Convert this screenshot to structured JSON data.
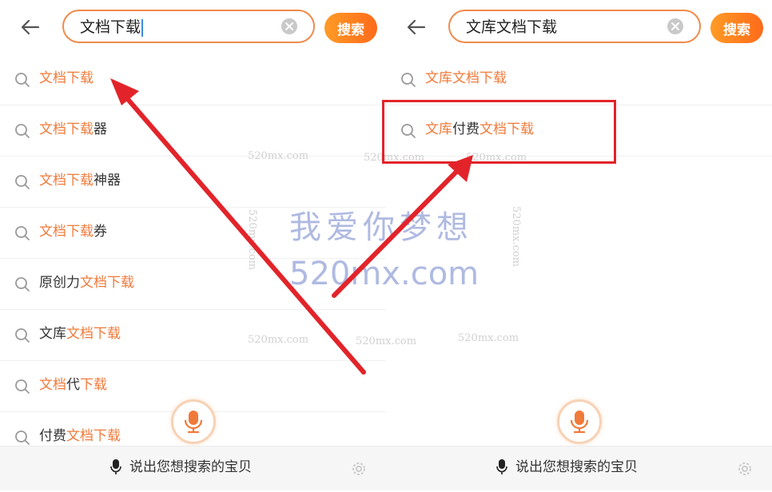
{
  "left_panel": {
    "query": "文档下载",
    "search_button": "搜索",
    "suggestions": [
      {
        "parts": [
          {
            "t": "文档下载",
            "h": true
          }
        ]
      },
      {
        "parts": [
          {
            "t": "文档下载",
            "h": true
          },
          {
            "t": "器",
            "h": false
          }
        ]
      },
      {
        "parts": [
          {
            "t": "文档下载",
            "h": true
          },
          {
            "t": "神器",
            "h": false
          }
        ]
      },
      {
        "parts": [
          {
            "t": "文档下载",
            "h": true
          },
          {
            "t": "券",
            "h": false
          }
        ]
      },
      {
        "parts": [
          {
            "t": "原创力",
            "h": false
          },
          {
            "t": "文档下载",
            "h": true
          }
        ]
      },
      {
        "parts": [
          {
            "t": "文库",
            "h": false
          },
          {
            "t": "文档下载",
            "h": true
          }
        ]
      },
      {
        "parts": [
          {
            "t": "文档",
            "h": true
          },
          {
            "t": "代",
            "h": false
          },
          {
            "t": "下载",
            "h": true
          }
        ]
      },
      {
        "parts": [
          {
            "t": "付费",
            "h": false
          },
          {
            "t": "文档下载",
            "h": true
          }
        ]
      }
    ],
    "voice_label": "说出您想搜索的宝贝"
  },
  "right_panel": {
    "query": "文库文档下载",
    "search_button": "搜索",
    "suggestions": [
      {
        "parts": [
          {
            "t": "文库文档下载",
            "h": true
          }
        ]
      },
      {
        "parts": [
          {
            "t": "文库",
            "h": true
          },
          {
            "t": "付费",
            "h": false
          },
          {
            "t": "文档下载",
            "h": true
          }
        ]
      }
    ],
    "voice_label": "说出您想搜索的宝贝"
  },
  "watermark": {
    "title": "我爱你梦想",
    "site": "520mx.com",
    "small": "520mx.com"
  },
  "colors": {
    "accent": "#f07a3a",
    "search_border": "#f08a4b",
    "annotation_red": "#e2242a"
  },
  "icons": {
    "back": "back-arrow-icon",
    "clear": "clear-circle-icon",
    "suggestion": "magnifier-icon",
    "mic": "microphone-icon",
    "settings": "gear-icon"
  }
}
